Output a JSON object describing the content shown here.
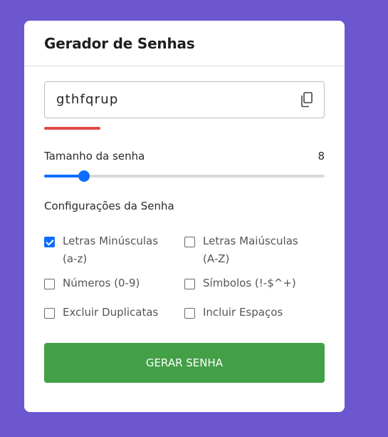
{
  "title": "Gerador de Senhas",
  "password": "gthfqrup",
  "strength_color": "#e04a4a",
  "length_label": "Tamanho da senha",
  "length_value": "8",
  "slider": {
    "value": 8,
    "min": 4,
    "max": 32
  },
  "settings_title": "Configurações da Senha",
  "options": [
    {
      "line1": "Letras Minúsculas",
      "line2": "(a-z)",
      "checked": true
    },
    {
      "line1": "Letras Maiúsculas",
      "line2": "(A-Z)",
      "checked": false
    },
    {
      "line1": "Números (0-9)",
      "line2": "",
      "checked": false
    },
    {
      "line1": "Símbolos (!-$^+)",
      "line2": "",
      "checked": false
    },
    {
      "line1": "Excluir Duplicatas",
      "line2": "",
      "checked": false
    },
    {
      "line1": "Incluir Espaços",
      "line2": "",
      "checked": false
    }
  ],
  "generate_button": "GERAR SENHA",
  "icons": {
    "copy": "copy-icon"
  },
  "colors": {
    "background": "#6c57cf",
    "accent": "#0d6efd",
    "button": "#43a047"
  }
}
